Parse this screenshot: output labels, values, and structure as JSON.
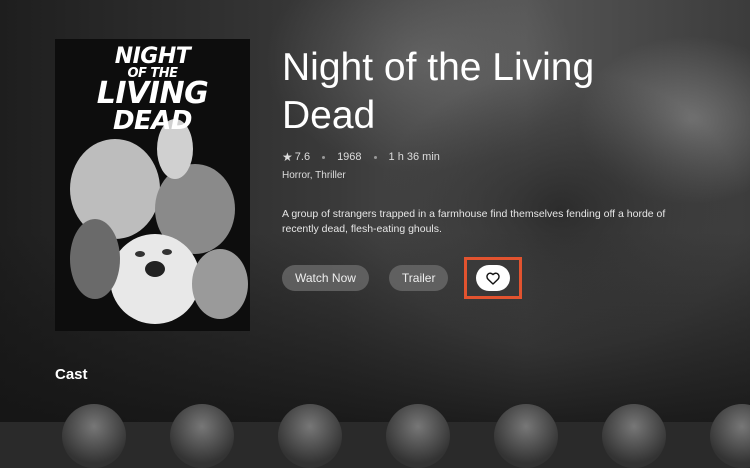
{
  "poster": {
    "title_lines": [
      "NIGHT",
      "OF THE",
      "LIVING",
      "DEAD"
    ]
  },
  "movie": {
    "title": "Night of the Living Dead",
    "rating": "7.6",
    "year": "1968",
    "runtime": "1 h 36 min",
    "genres": "Horror, Thriller",
    "overview": "A group of strangers trapped in a farmhouse find themselves fending off a horde of recently dead, flesh-eating ghouls."
  },
  "actions": {
    "watch_label": "Watch Now",
    "trailer_label": "Trailer",
    "favorite_icon": "heart-icon",
    "highlight_color": "#e2532f"
  },
  "cast": {
    "label": "Cast",
    "count_visible": 7
  },
  "icons": {
    "rating": "star-icon"
  }
}
